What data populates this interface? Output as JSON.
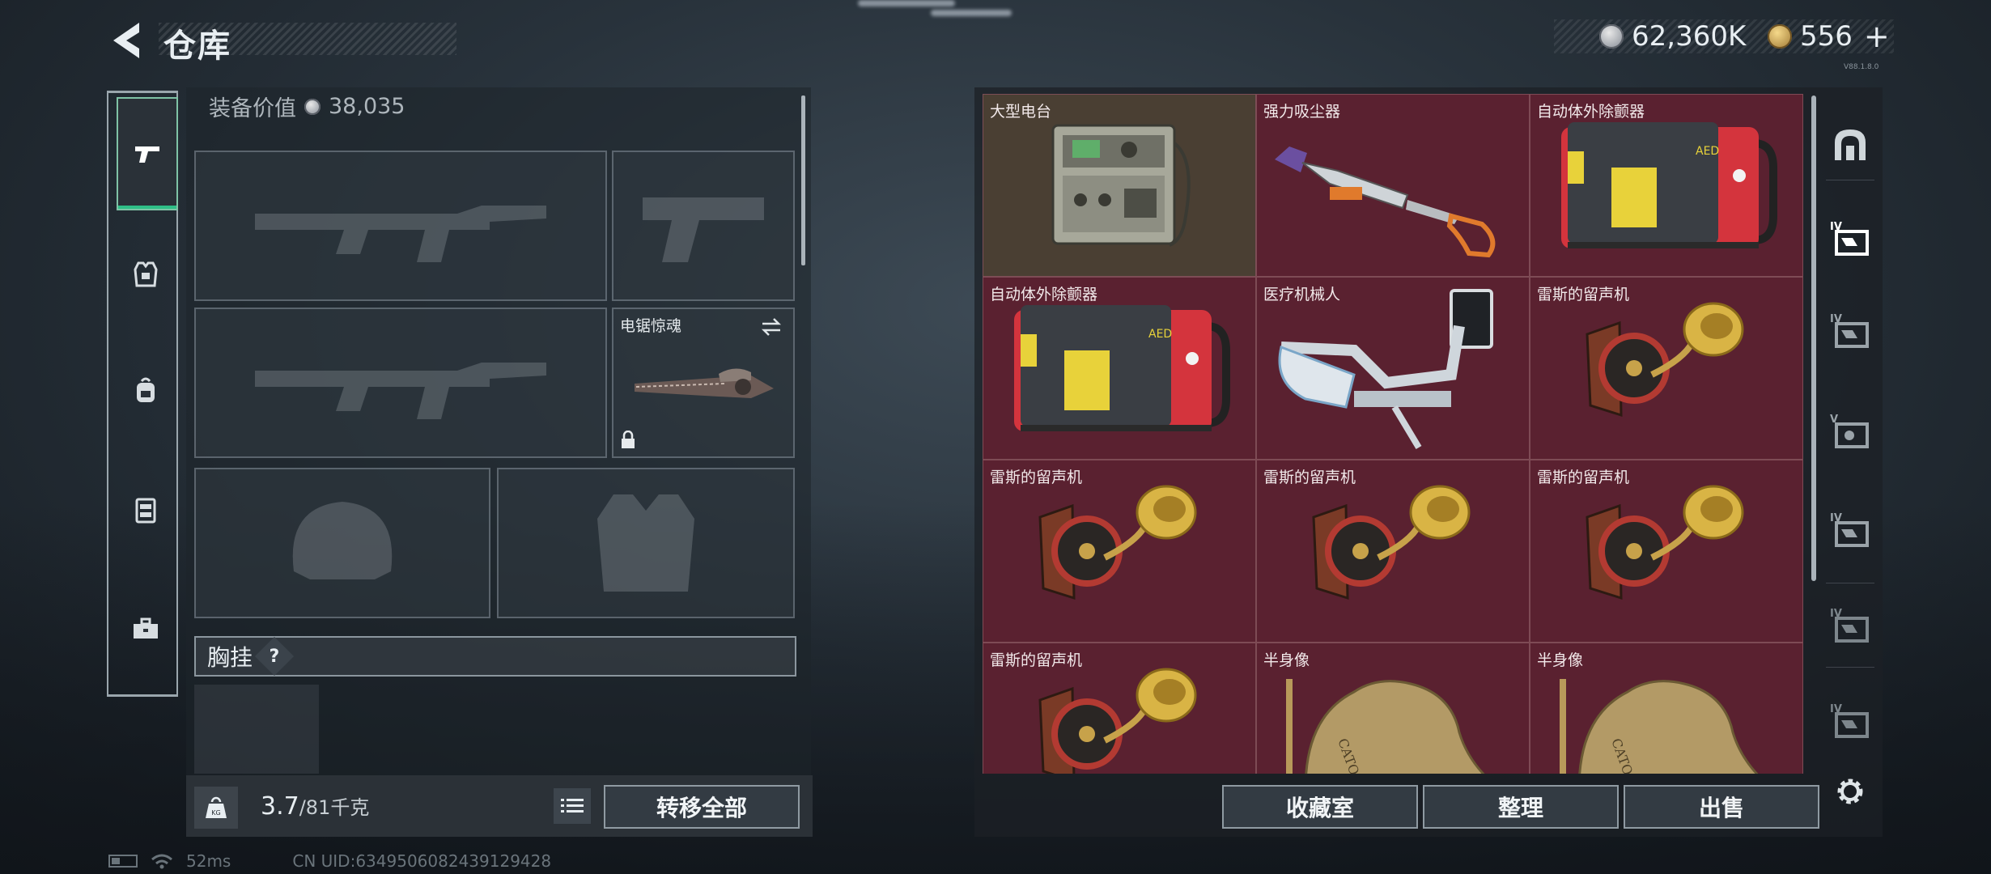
{
  "header": {
    "title": "仓库",
    "silver_amount": "62,360K",
    "gold_amount": "556",
    "plus_label": "+",
    "version": "V88.1.8.0"
  },
  "left_rail": {
    "tabs": [
      {
        "name": "weapons",
        "icon": "pistol-icon",
        "active": true
      },
      {
        "name": "armor",
        "icon": "armor-vest-icon",
        "active": false
      },
      {
        "name": "backpack",
        "icon": "backpack-icon",
        "active": false
      },
      {
        "name": "chest-rig",
        "icon": "rig-icon",
        "active": false
      },
      {
        "name": "toolbox",
        "icon": "toolbox-icon",
        "active": false
      }
    ]
  },
  "equipment": {
    "value_label": "装备价值",
    "value_amount": "38,035",
    "slots": [
      {
        "id": "primary-weapon-1",
        "item": "",
        "ghost": "rifle-silhouette-icon"
      },
      {
        "id": "sidearm",
        "item": "",
        "ghost": "pistol-silhouette-icon"
      },
      {
        "id": "primary-weapon-2",
        "item": "",
        "ghost": "rifle-silhouette-icon"
      },
      {
        "id": "melee",
        "item": "电锯惊魂",
        "locked": true,
        "swap": true
      },
      {
        "id": "helmet",
        "item": "",
        "ghost": "helmet-silhouette-icon"
      },
      {
        "id": "body-armor",
        "item": "",
        "ghost": "vest-silhouette-icon"
      }
    ],
    "chest_label": "胸挂",
    "help_label": "?"
  },
  "footer_left": {
    "kg_label": "KG",
    "weight_current": "3.7",
    "weight_max": "/81千克",
    "transfer_all_label": "转移全部"
  },
  "stash": {
    "items": [
      {
        "name": "大型电台",
        "icon": "radio-station-icon",
        "rarity": "gold"
      },
      {
        "name": "强力吸尘器",
        "icon": "vacuum-cleaner-icon",
        "rarity": "red"
      },
      {
        "name": "自动体外除颤器",
        "icon": "aed-icon",
        "rarity": "red"
      },
      {
        "name": "自动体外除颤器",
        "icon": "aed-icon",
        "rarity": "red"
      },
      {
        "name": "医疗机械人",
        "icon": "medical-robot-icon",
        "rarity": "red"
      },
      {
        "name": "雷斯的留声机",
        "icon": "gramophone-icon",
        "rarity": "red"
      },
      {
        "name": "雷斯的留声机",
        "icon": "gramophone-icon",
        "rarity": "red"
      },
      {
        "name": "雷斯的留声机",
        "icon": "gramophone-icon",
        "rarity": "red"
      },
      {
        "name": "雷斯的留声机",
        "icon": "gramophone-icon",
        "rarity": "red"
      },
      {
        "name": "雷斯的留声机",
        "icon": "gramophone-icon",
        "rarity": "red"
      },
      {
        "name": "半身像",
        "icon": "bust-statue-icon",
        "rarity": "red"
      },
      {
        "name": "半身像",
        "icon": "bust-statue-icon",
        "rarity": "red"
      }
    ],
    "aed_badge": "AED",
    "bust_inscription": "CATO"
  },
  "side_tabs": [
    {
      "name": "stash-home",
      "icon": "stash-arch-icon",
      "label": ""
    },
    {
      "name": "stash-iv-1",
      "icon": "stash-box-icon",
      "label": "IV"
    },
    {
      "name": "stash-iv-2",
      "icon": "stash-box-icon",
      "label": "IV"
    },
    {
      "name": "stash-v",
      "icon": "stash-box-icon",
      "label": "V"
    },
    {
      "name": "stash-iv-3",
      "icon": "stash-box-icon",
      "label": "IV"
    },
    {
      "name": "stash-iv-4",
      "icon": "stash-box-icon",
      "label": "IV"
    },
    {
      "name": "stash-iv-5",
      "icon": "stash-box-icon",
      "label": "IV"
    }
  ],
  "footer_right": {
    "collection_label": "收藏室",
    "sort_label": "整理",
    "sell_label": "出售"
  },
  "status_bar": {
    "ping": "52ms",
    "uid": "CN UID:6349506082439129428"
  },
  "colors": {
    "rarity_red": "#5a2130",
    "rarity_gold": "#4a3f33",
    "accent_green": "#2fbf87"
  }
}
